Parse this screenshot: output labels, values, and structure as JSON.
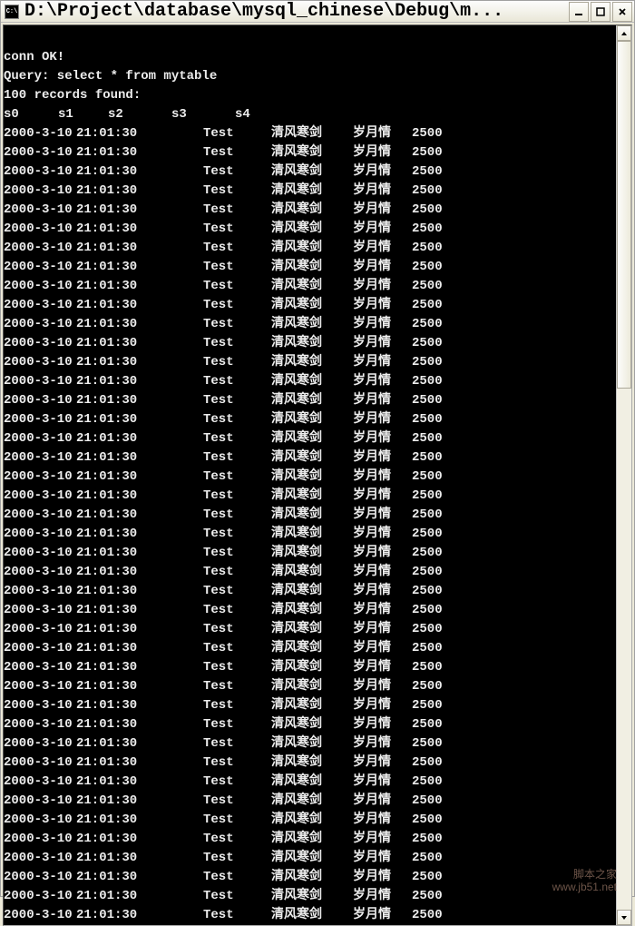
{
  "window": {
    "title": "D:\\Project\\database\\mysql_chinese\\Debug\\m...",
    "icon_label": "C:\\"
  },
  "console": {
    "line1": "conn OK!",
    "line2": "Query: select * from mytable",
    "line3": "100 records found:",
    "headers": {
      "s0": "s0",
      "s1": "s1",
      "s2": "s2",
      "s3": "s3",
      "s4": "s4"
    },
    "row_count": 42,
    "row": {
      "date": "2000-3-10",
      "time": "21:01:30",
      "s2": "Test",
      "s3": "清风寒剑",
      "s4a": "岁月情",
      "s4b": "2500"
    }
  },
  "watermark": {
    "line1": "脚本之家",
    "line2": "www.jb51.net"
  }
}
